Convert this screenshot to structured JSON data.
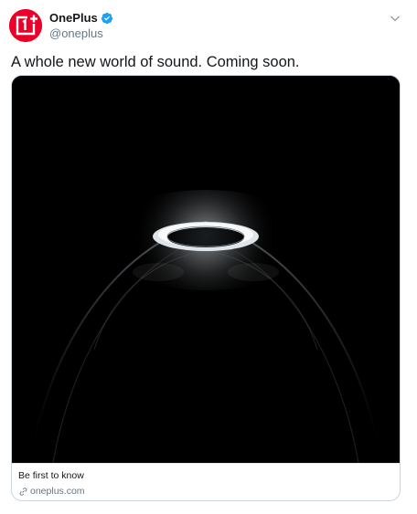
{
  "tweet": {
    "author": {
      "display_name": "OnePlus",
      "handle": "@oneplus",
      "verified": true,
      "avatar_color": "#eb0029"
    },
    "text": "A whole new world of sound. Coming soon.",
    "card": {
      "title": "Be first to know",
      "domain": "oneplus.com",
      "image_background": "#000000"
    },
    "icons": {
      "verified": "verified-badge-icon",
      "menu": "chevron-down-icon",
      "link": "link-icon"
    }
  }
}
